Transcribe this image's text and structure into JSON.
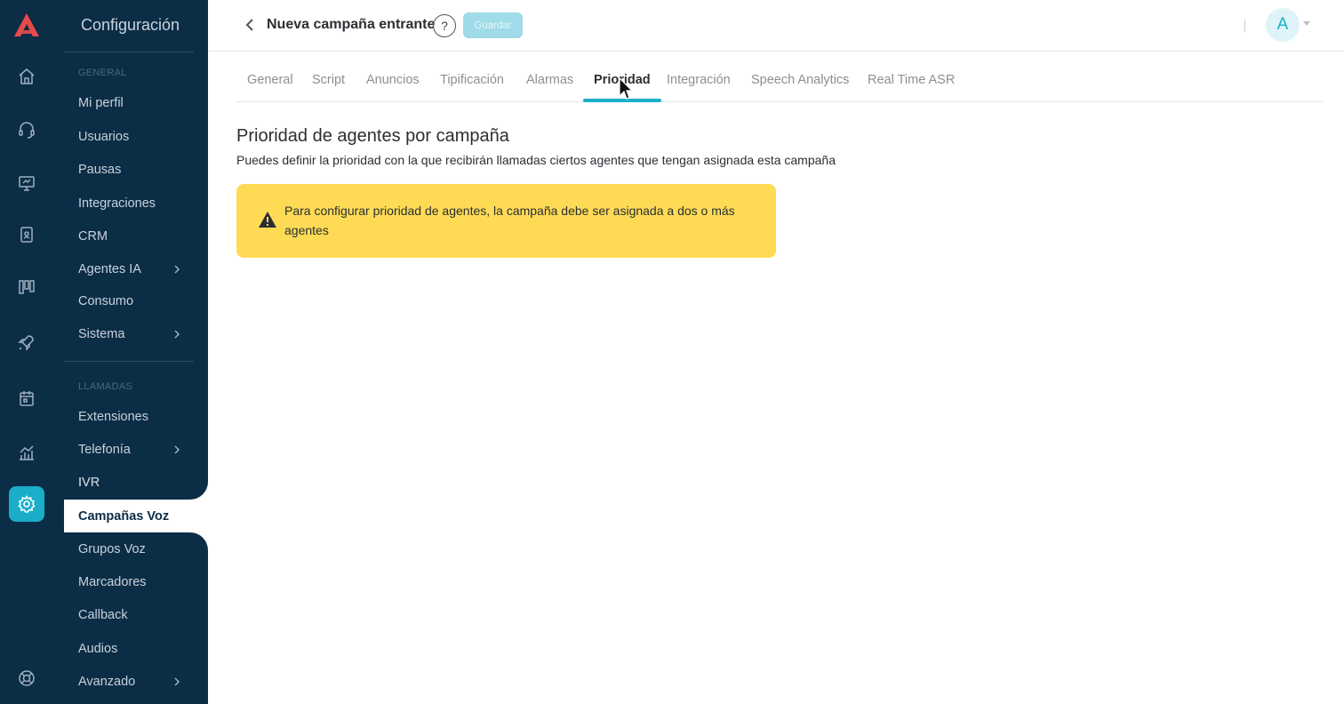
{
  "sidebar": {
    "title": "Configuración",
    "sections": {
      "general": "GENERAL",
      "llamadas": "LLAMADAS"
    },
    "general_items": [
      {
        "label": "Mi perfil"
      },
      {
        "label": "Usuarios"
      },
      {
        "label": "Pausas"
      },
      {
        "label": "Integraciones"
      },
      {
        "label": "CRM"
      },
      {
        "label": "Agentes IA"
      },
      {
        "label": "Consumo"
      },
      {
        "label": "Sistema"
      }
    ],
    "llamadas_items": [
      {
        "label": "Extensiones"
      },
      {
        "label": "Telefonía"
      },
      {
        "label": "IVR"
      },
      {
        "label": "Campañas Voz"
      },
      {
        "label": "Grupos Voz"
      },
      {
        "label": "Marcadores"
      },
      {
        "label": "Callback"
      },
      {
        "label": "Audios"
      },
      {
        "label": "Avanzado"
      }
    ],
    "active_item": "Campañas Voz"
  },
  "header": {
    "title": "Nueva campaña entrante",
    "help_label": "?",
    "save_label": "Guardar",
    "avatar_initial": "A"
  },
  "tabs": [
    {
      "label": "General"
    },
    {
      "label": "Script"
    },
    {
      "label": "Anuncios"
    },
    {
      "label": "Tipificación"
    },
    {
      "label": "Alarmas"
    },
    {
      "label": "Prioridad"
    },
    {
      "label": "Integración"
    },
    {
      "label": "Speech Analytics"
    },
    {
      "label": "Real Time ASR"
    }
  ],
  "active_tab": "Prioridad",
  "content": {
    "title": "Prioridad de agentes por campaña",
    "description": "Puedes definir la prioridad con la que recibirán llamadas ciertos agentes que tengan asignada esta campaña",
    "alert": "Para configurar prioridad de agentes, la campaña debe ser asignada a dos o más agentes"
  },
  "colors": {
    "sidebar_bg": "#0c2d46",
    "accent": "#1aaec8",
    "alert_bg": "#ffdb55",
    "save_bg": "#9fdbe8"
  }
}
